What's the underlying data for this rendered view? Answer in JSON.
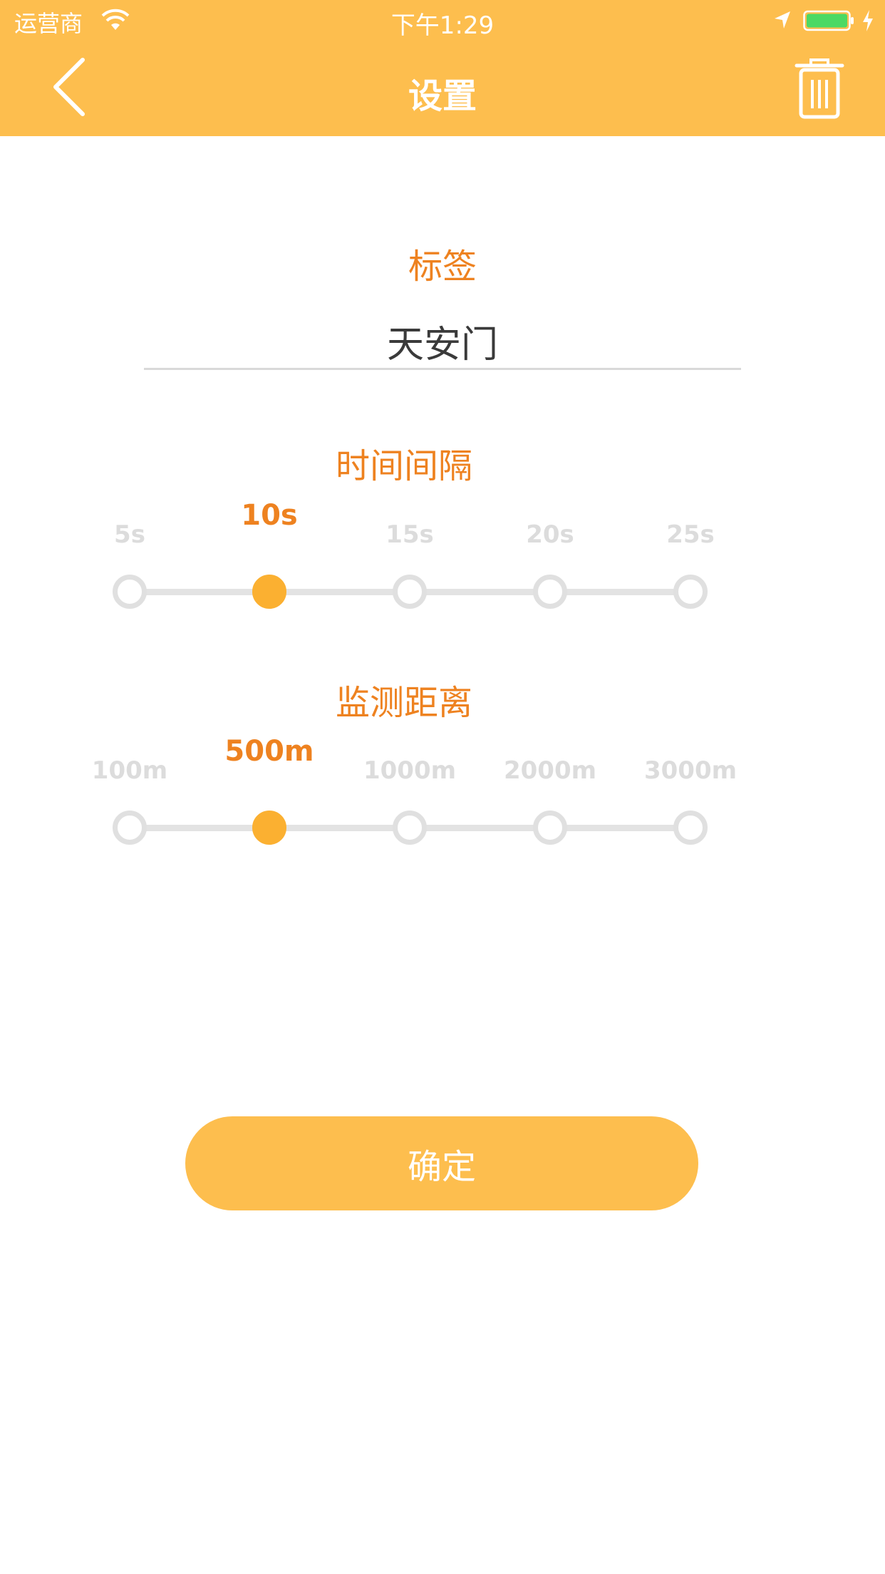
{
  "status_bar": {
    "carrier": "运营商",
    "time": "下午1:29"
  },
  "header": {
    "title": "设置",
    "back_icon": "chevron-left-icon",
    "delete_icon": "trash-icon"
  },
  "label_section": {
    "title": "标签",
    "value": "天安门"
  },
  "interval_section": {
    "title": "时间间隔",
    "options": [
      "5s",
      "10s",
      "15s",
      "20s",
      "25s"
    ],
    "selected_index": 1
  },
  "distance_section": {
    "title": "监测距离",
    "options": [
      "100m",
      "500m",
      "1000m",
      "2000m",
      "3000m"
    ],
    "selected_index": 1
  },
  "confirm_button": {
    "label": "确定"
  },
  "colors": {
    "accent": "#FDBE4E",
    "title_orange": "#EE8220",
    "selected_dot": "#FBB031",
    "inactive": "#E0E0E0"
  }
}
